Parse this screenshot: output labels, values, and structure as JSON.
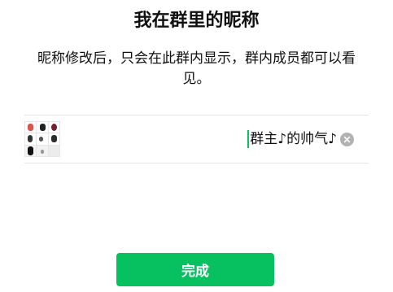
{
  "header": {
    "title": "我在群里的昵称"
  },
  "description": "昵称修改后，只会在此群内显示，群内成员都可以看见。",
  "nickname_row": {
    "avatar_icon": "group-avatar-grid",
    "value": "群主♪的帅气♪",
    "clear_icon": "clear-circle-icon"
  },
  "done_button": {
    "label": "完成"
  },
  "colors": {
    "accent": "#07C160",
    "divider": "#E5E5E5",
    "clear_icon": "#B2B2B2"
  }
}
